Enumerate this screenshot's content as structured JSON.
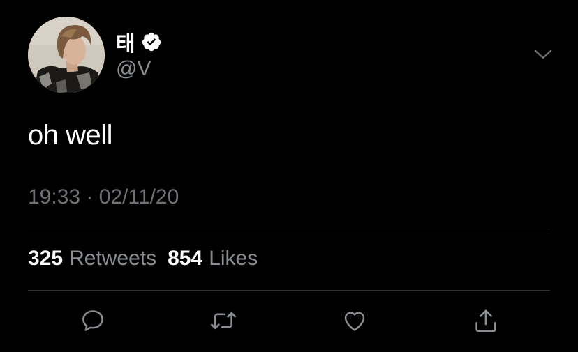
{
  "tweet": {
    "display_name": "태",
    "handle": "@V",
    "text": "oh well",
    "timestamp": "19:33 · 02/11/20",
    "retweets_count": "325",
    "retweets_label": "Retweets",
    "likes_count": "854",
    "likes_label": "Likes",
    "verified": true
  },
  "icons": {
    "verified": "verified-badge-icon",
    "caret": "chevron-down-icon",
    "reply": "reply-icon",
    "retweet": "retweet-icon",
    "like": "heart-icon",
    "share": "share-icon"
  },
  "colors": {
    "background": "#000000",
    "primary_text": "#ffffff",
    "secondary_text": "#8a8d91",
    "divider": "#2f3336",
    "icon": "#8a8d91"
  }
}
